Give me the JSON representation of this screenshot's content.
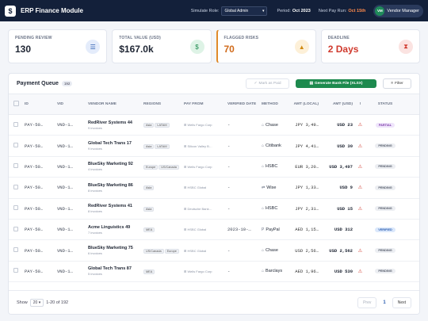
{
  "app": {
    "logo": "$",
    "title": "ERP Finance Module"
  },
  "topbar": {
    "role_label": "Simulate Role:",
    "role_value": "Global Admin",
    "period_label": "Period:",
    "period_value": "Oct 2023",
    "next_pay_label": "Next Pay Run:",
    "next_pay_value": "Oct 15th",
    "user_initials": "VM",
    "user_name": "Vendor Manager"
  },
  "kpis": [
    {
      "label": "PENDING REVIEW",
      "value": "130",
      "icon": "list-check-icon",
      "color": "#1e2533"
    },
    {
      "label": "TOTAL VALUE (USD)",
      "value": "$167.0k",
      "icon": "money-bill-icon",
      "color": "#1e2533"
    },
    {
      "label": "FLAGGED RISKS",
      "value": "70",
      "icon": "warning-icon",
      "color": "#d06a1a"
    },
    {
      "label": "DEADLINE",
      "value": "2 Days",
      "icon": "hourglass-icon",
      "color": "#d03a2e"
    }
  ],
  "panel": {
    "title": "Payment Queue",
    "count": "192",
    "mark_paid": "Mark as Paid",
    "generate": "Generate Bank File (XLSX)",
    "filter": "Filter"
  },
  "columns": [
    "ID",
    "VID",
    "VENDOR NAME",
    "REGIONS",
    "PAY FROM",
    "VERIFIED DATE",
    "METHOD",
    "AMT (LOCAL)",
    "AMT (USD)",
    "!",
    "STATUS"
  ],
  "rows": [
    {
      "id": "PAY-50…",
      "vid": "VND-1…",
      "vendor": "RedRiver Systems 44",
      "invoices": "9 invoices",
      "regions": [
        "Asia",
        "LATAM"
      ],
      "pay_from": "Wells Fargo Corp",
      "verified": "-",
      "method": "Chase",
      "amt_local": "JPY 3,49…",
      "amt_usd": "USD 23",
      "risk": "⚠",
      "status": "PARTIAL",
      "status_class": "b-partial"
    },
    {
      "id": "PAY-50…",
      "vid": "VND-1…",
      "vendor": "Global Tech Trans 17",
      "invoices": "9 invoices",
      "regions": [
        "Asia",
        "LATAM"
      ],
      "pay_from": "Silicon Valley B…",
      "verified": "-",
      "method": "Citibank",
      "amt_local": "JPY 4,41…",
      "amt_usd": "USD 30",
      "risk": "⚠",
      "status": "PENDING",
      "status_class": "b-pending"
    },
    {
      "id": "PAY-50…",
      "vid": "VND-1…",
      "vendor": "BlueSky Marketing 92",
      "invoices": "4 invoices",
      "regions": [
        "Europe",
        "US/Canada"
      ],
      "pay_from": "Wells Fargo Corp",
      "verified": "-",
      "method": "HSBC",
      "amt_local": "EUR 3,20…",
      "amt_usd": "USD 3,497",
      "risk": "⚠",
      "status": "PENDING",
      "status_class": "b-pending"
    },
    {
      "id": "PAY-50…",
      "vid": "VND-1…",
      "vendor": "BlueSky Marketing 86",
      "invoices": "8 invoices",
      "regions": [
        "Asia"
      ],
      "pay_from": "HSBC Global",
      "verified": "-",
      "method": "Wise",
      "amt_local": "JPY 1,33…",
      "amt_usd": "USD 9",
      "risk": "⚠",
      "status": "PENDING",
      "status_class": "b-pending"
    },
    {
      "id": "PAY-50…",
      "vid": "VND-1…",
      "vendor": "RedRiver Systems 41",
      "invoices": "8 invoices",
      "regions": [
        "Asia"
      ],
      "pay_from": "Deutsche Bank…",
      "verified": "-",
      "method": "HSBC",
      "amt_local": "JPY 2,31…",
      "amt_usd": "USD 15",
      "risk": "⚠",
      "status": "PENDING",
      "status_class": "b-pending"
    },
    {
      "id": "PAY-50…",
      "vid": "VND-1…",
      "vendor": "Acme Linguistics 49",
      "invoices": "7 invoices",
      "regions": [
        "MEA"
      ],
      "pay_from": "HSBC Global",
      "verified": "2023-10-…",
      "method": "PayPal",
      "amt_local": "AED 1,15…",
      "amt_usd": "USD 312",
      "risk": "",
      "status": "VERIFIED",
      "status_class": "b-verified"
    },
    {
      "id": "PAY-50…",
      "vid": "VND-1…",
      "vendor": "BlueSky Marketing 75",
      "invoices": "6 invoices",
      "regions": [
        "US/Canada",
        "Europe"
      ],
      "pay_from": "HSBC Global",
      "verified": "-",
      "method": "Chase",
      "amt_local": "USD 2,56…",
      "amt_usd": "USD 2,562",
      "risk": "⚠",
      "status": "PENDING",
      "status_class": "b-pending"
    },
    {
      "id": "PAY-50…",
      "vid": "VND-1…",
      "vendor": "Global Tech Trans 87",
      "invoices": "5 invoices",
      "regions": [
        "MEA"
      ],
      "pay_from": "Wells Fargo Corp",
      "verified": "-",
      "method": "Barclays",
      "amt_local": "AED 1,96…",
      "amt_usd": "USD 530",
      "risk": "⚠",
      "status": "PENDING",
      "status_class": "b-pending"
    }
  ],
  "footer": {
    "show_label": "Show",
    "page_size": "20",
    "range": "1-20 of 192",
    "prev": "Prev",
    "page": "1",
    "next": "Next"
  }
}
